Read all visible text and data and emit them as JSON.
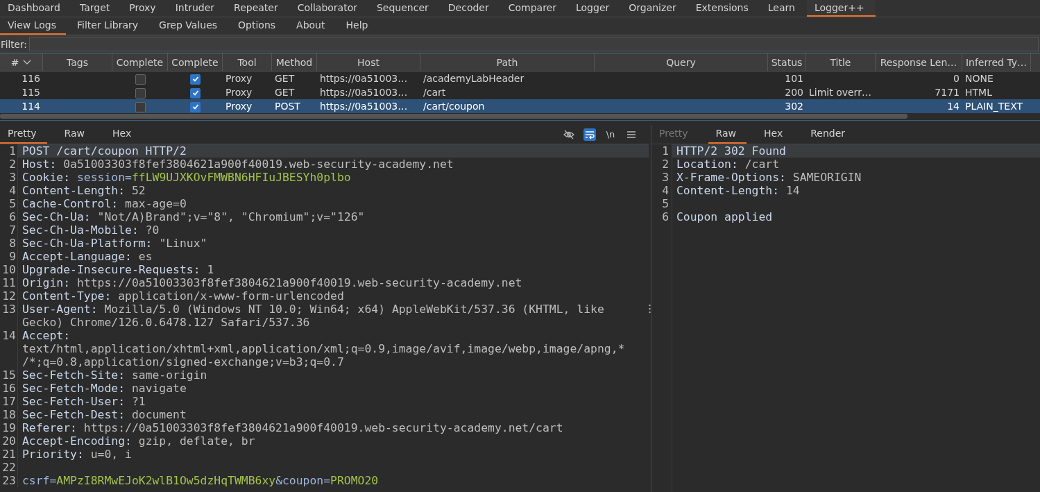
{
  "main_tabs": [
    {
      "label": "Dashboard",
      "selected": false
    },
    {
      "label": "Target",
      "selected": false
    },
    {
      "label": "Proxy",
      "selected": false
    },
    {
      "label": "Intruder",
      "selected": false
    },
    {
      "label": "Repeater",
      "selected": false
    },
    {
      "label": "Collaborator",
      "selected": false
    },
    {
      "label": "Sequencer",
      "selected": false
    },
    {
      "label": "Decoder",
      "selected": false
    },
    {
      "label": "Comparer",
      "selected": false
    },
    {
      "label": "Logger",
      "selected": false
    },
    {
      "label": "Organizer",
      "selected": false
    },
    {
      "label": "Extensions",
      "selected": false
    },
    {
      "label": "Learn",
      "selected": false
    },
    {
      "label": "Logger++",
      "selected": true
    }
  ],
  "sub_tabs": [
    {
      "label": "View Logs",
      "selected": true
    },
    {
      "label": "Filter Library",
      "selected": false
    },
    {
      "label": "Grep Values",
      "selected": false
    },
    {
      "label": "Options",
      "selected": false
    },
    {
      "label": "About",
      "selected": false
    },
    {
      "label": "Help",
      "selected": false
    }
  ],
  "filter": {
    "label": "Filter:"
  },
  "table": {
    "columns": [
      {
        "label": "#",
        "sorted": true
      },
      {
        "label": "Tags",
        "sorted": false
      },
      {
        "label": "Complete",
        "sorted": false
      },
      {
        "label": "Complete",
        "sorted": false
      },
      {
        "label": "Tool",
        "sorted": false
      },
      {
        "label": "Method",
        "sorted": false
      },
      {
        "label": "Host",
        "sorted": false
      },
      {
        "label": "Path",
        "sorted": false
      },
      {
        "label": "Query",
        "sorted": false
      },
      {
        "label": "Status",
        "sorted": false
      },
      {
        "label": "Title",
        "sorted": false
      },
      {
        "label": "Response Len…",
        "sorted": false
      },
      {
        "label": "Inferred Ty…",
        "sorted": false
      }
    ],
    "rows": [
      {
        "num": "116",
        "complete_1": false,
        "complete_2": true,
        "tool": "Proxy",
        "method": "GET",
        "host": "https://0a51003…",
        "path": "/academyLabHeader",
        "status": "101",
        "title": "",
        "length": "0",
        "type": "NONE",
        "selected": false
      },
      {
        "num": "115",
        "complete_1": false,
        "complete_2": true,
        "tool": "Proxy",
        "method": "GET",
        "host": "https://0a51003…",
        "path": "/cart",
        "status": "200",
        "title": "Limit overr…",
        "length": "7171",
        "type": "HTML",
        "selected": false
      },
      {
        "num": "114",
        "complete_1": false,
        "complete_2": true,
        "tool": "Proxy",
        "method": "POST",
        "host": "https://0a51003…",
        "path": "/cart/coupon",
        "status": "302",
        "title": "",
        "length": "14",
        "type": "PLAIN_TEXT",
        "selected": true
      }
    ]
  },
  "request": {
    "tabs": [
      {
        "label": "Pretty",
        "selected": true
      },
      {
        "label": "Raw",
        "selected": false
      },
      {
        "label": "Hex",
        "selected": false
      }
    ],
    "toolbar": [
      {
        "kind": "eye-off",
        "on": false
      },
      {
        "kind": "wrap",
        "on": true
      },
      {
        "kind": "newline",
        "label": "\\n",
        "on": false
      },
      {
        "kind": "menu",
        "on": false
      }
    ],
    "lines": [
      {
        "n": "1",
        "parts": [
          {
            "kind": "key",
            "text": "POST /cart/coupon HTTP/2"
          }
        ],
        "current": true
      },
      {
        "n": "2",
        "parts": [
          {
            "kind": "key",
            "text": "Host: "
          },
          {
            "kind": "val",
            "text": "0a51003303f8fef3804621a900f40019.web-security-academy.net"
          }
        ],
        "current": false
      },
      {
        "n": "3",
        "parts": [
          {
            "kind": "key",
            "text": "Cookie: "
          },
          {
            "kind": "param",
            "text": "session="
          },
          {
            "kind": "str",
            "text": "ffLW9UJXKOvFMWBN6HFIuJBESYh0plbo"
          }
        ],
        "current": false
      },
      {
        "n": "4",
        "parts": [
          {
            "kind": "key",
            "text": "Content-Length: "
          },
          {
            "kind": "val",
            "text": "52"
          }
        ],
        "current": false
      },
      {
        "n": "5",
        "parts": [
          {
            "kind": "key",
            "text": "Cache-Control: "
          },
          {
            "kind": "val",
            "text": "max-age=0"
          }
        ],
        "current": false
      },
      {
        "n": "6",
        "parts": [
          {
            "kind": "key",
            "text": "Sec-Ch-Ua: "
          },
          {
            "kind": "val",
            "text": "\"Not/A)Brand\";v=\"8\", \"Chromium\";v=\"126\""
          }
        ],
        "current": false
      },
      {
        "n": "7",
        "parts": [
          {
            "kind": "key",
            "text": "Sec-Ch-Ua-Mobile: "
          },
          {
            "kind": "val",
            "text": "?0"
          }
        ],
        "current": false
      },
      {
        "n": "8",
        "parts": [
          {
            "kind": "key",
            "text": "Sec-Ch-Ua-Platform: "
          },
          {
            "kind": "val",
            "text": "\"Linux\""
          }
        ],
        "current": false
      },
      {
        "n": "9",
        "parts": [
          {
            "kind": "key",
            "text": "Accept-Language: "
          },
          {
            "kind": "val",
            "text": "es"
          }
        ],
        "current": false
      },
      {
        "n": "10",
        "parts": [
          {
            "kind": "key",
            "text": "Upgrade-Insecure-Requests: "
          },
          {
            "kind": "val",
            "text": "1"
          }
        ],
        "current": false
      },
      {
        "n": "11",
        "parts": [
          {
            "kind": "key",
            "text": "Origin: "
          },
          {
            "kind": "val",
            "text": "https://0a51003303f8fef3804621a900f40019.web-security-academy.net"
          }
        ],
        "current": false
      },
      {
        "n": "12",
        "parts": [
          {
            "kind": "key",
            "text": "Content-Type: "
          },
          {
            "kind": "val",
            "text": "application/x-www-form-urlencoded"
          }
        ],
        "current": false
      },
      {
        "n": "13",
        "parts": [
          {
            "kind": "key",
            "text": "User-Agent: "
          },
          {
            "kind": "val",
            "text": "Mozilla/5.0 (Windows NT 10.0; Win64; x64) AppleWebKit/537.36 (KHTML, like"
          }
        ],
        "more": [
          "Gecko) Chrome/126.0.6478.127 Safari/537.36"
        ],
        "current": false
      },
      {
        "n": "14",
        "parts": [
          {
            "kind": "key",
            "text": "Accept: "
          }
        ],
        "more": [
          "text/html,application/xhtml+xml,application/xml;q=0.9,image/avif,image/webp,image/apng,*",
          "/*;q=0.8,application/signed-exchange;v=b3;q=0.7"
        ],
        "current": false
      },
      {
        "n": "15",
        "parts": [
          {
            "kind": "key",
            "text": "Sec-Fetch-Site: "
          },
          {
            "kind": "val",
            "text": "same-origin"
          }
        ],
        "current": false
      },
      {
        "n": "16",
        "parts": [
          {
            "kind": "key",
            "text": "Sec-Fetch-Mode: "
          },
          {
            "kind": "val",
            "text": "navigate"
          }
        ],
        "current": false
      },
      {
        "n": "17",
        "parts": [
          {
            "kind": "key",
            "text": "Sec-Fetch-User: "
          },
          {
            "kind": "val",
            "text": "?1"
          }
        ],
        "current": false
      },
      {
        "n": "18",
        "parts": [
          {
            "kind": "key",
            "text": "Sec-Fetch-Dest: "
          },
          {
            "kind": "val",
            "text": "document"
          }
        ],
        "current": false
      },
      {
        "n": "19",
        "parts": [
          {
            "kind": "key",
            "text": "Referer: "
          },
          {
            "kind": "val",
            "text": "https://0a51003303f8fef3804621a900f40019.web-security-academy.net/cart"
          }
        ],
        "current": false
      },
      {
        "n": "20",
        "parts": [
          {
            "kind": "key",
            "text": "Accept-Encoding: "
          },
          {
            "kind": "val",
            "text": "gzip, deflate, br"
          }
        ],
        "current": false
      },
      {
        "n": "21",
        "parts": [
          {
            "kind": "key",
            "text": "Priority: "
          },
          {
            "kind": "val",
            "text": "u=0, i"
          }
        ],
        "current": false
      },
      {
        "n": "22",
        "current": false
      },
      {
        "n": "23",
        "parts": [
          {
            "kind": "param",
            "text": "csrf="
          },
          {
            "kind": "str",
            "text": "AMPzI8RMwEJoK2wlB1Ow5dzHqTWMB6xy"
          },
          {
            "kind": "param",
            "text": "&coupon="
          },
          {
            "kind": "str",
            "text": "PROMO20"
          }
        ],
        "current": false
      }
    ]
  },
  "response": {
    "tabs": [
      {
        "label": "Pretty",
        "selected": false,
        "disabled": true
      },
      {
        "label": "Raw",
        "selected": true,
        "disabled": false
      },
      {
        "label": "Hex",
        "selected": false,
        "disabled": false
      },
      {
        "label": "Render",
        "selected": false,
        "disabled": false
      }
    ],
    "lines": [
      {
        "n": "1",
        "parts": [
          {
            "kind": "key",
            "text": "HTTP/2 302 Found"
          }
        ],
        "current": true
      },
      {
        "n": "2",
        "parts": [
          {
            "kind": "key",
            "text": "Location: "
          },
          {
            "kind": "val",
            "text": "/cart"
          }
        ],
        "current": false
      },
      {
        "n": "3",
        "parts": [
          {
            "kind": "key",
            "text": "X-Frame-Options: "
          },
          {
            "kind": "val",
            "text": "SAMEORIGIN"
          }
        ],
        "current": false
      },
      {
        "n": "4",
        "parts": [
          {
            "kind": "key",
            "text": "Content-Length: "
          },
          {
            "kind": "val",
            "text": "14"
          }
        ],
        "current": false
      },
      {
        "n": "5",
        "current": false
      },
      {
        "n": "6",
        "parts": [
          {
            "kind": "key",
            "text": "Coupon applied"
          }
        ],
        "current": false
      }
    ]
  }
}
